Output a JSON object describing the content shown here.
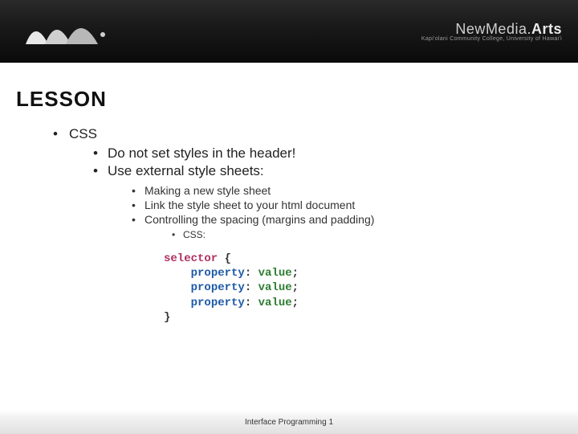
{
  "brand": {
    "title_light": "New",
    "title_mid": "Media",
    "title_bold": "Arts",
    "subtitle": "Kapi'olani Community College, University of Hawai'i"
  },
  "lesson_title": "LESSON",
  "top_bullet": "CSS",
  "sub_bullets": {
    "a": "Do not set styles in the header!",
    "b": "Use external style sheets:"
  },
  "subsub_bullets": {
    "a": "Making a new style sheet",
    "b": "Link the style sheet to your html document",
    "c": "Controlling the spacing (margins and padding)"
  },
  "css_label": "CSS:",
  "code": {
    "selector": "selector",
    "open": " {",
    "indent": "    ",
    "prop": "property",
    "colon": ": ",
    "val": "value",
    "semi": ";",
    "close": "}"
  },
  "footer": "Interface Programming 1"
}
